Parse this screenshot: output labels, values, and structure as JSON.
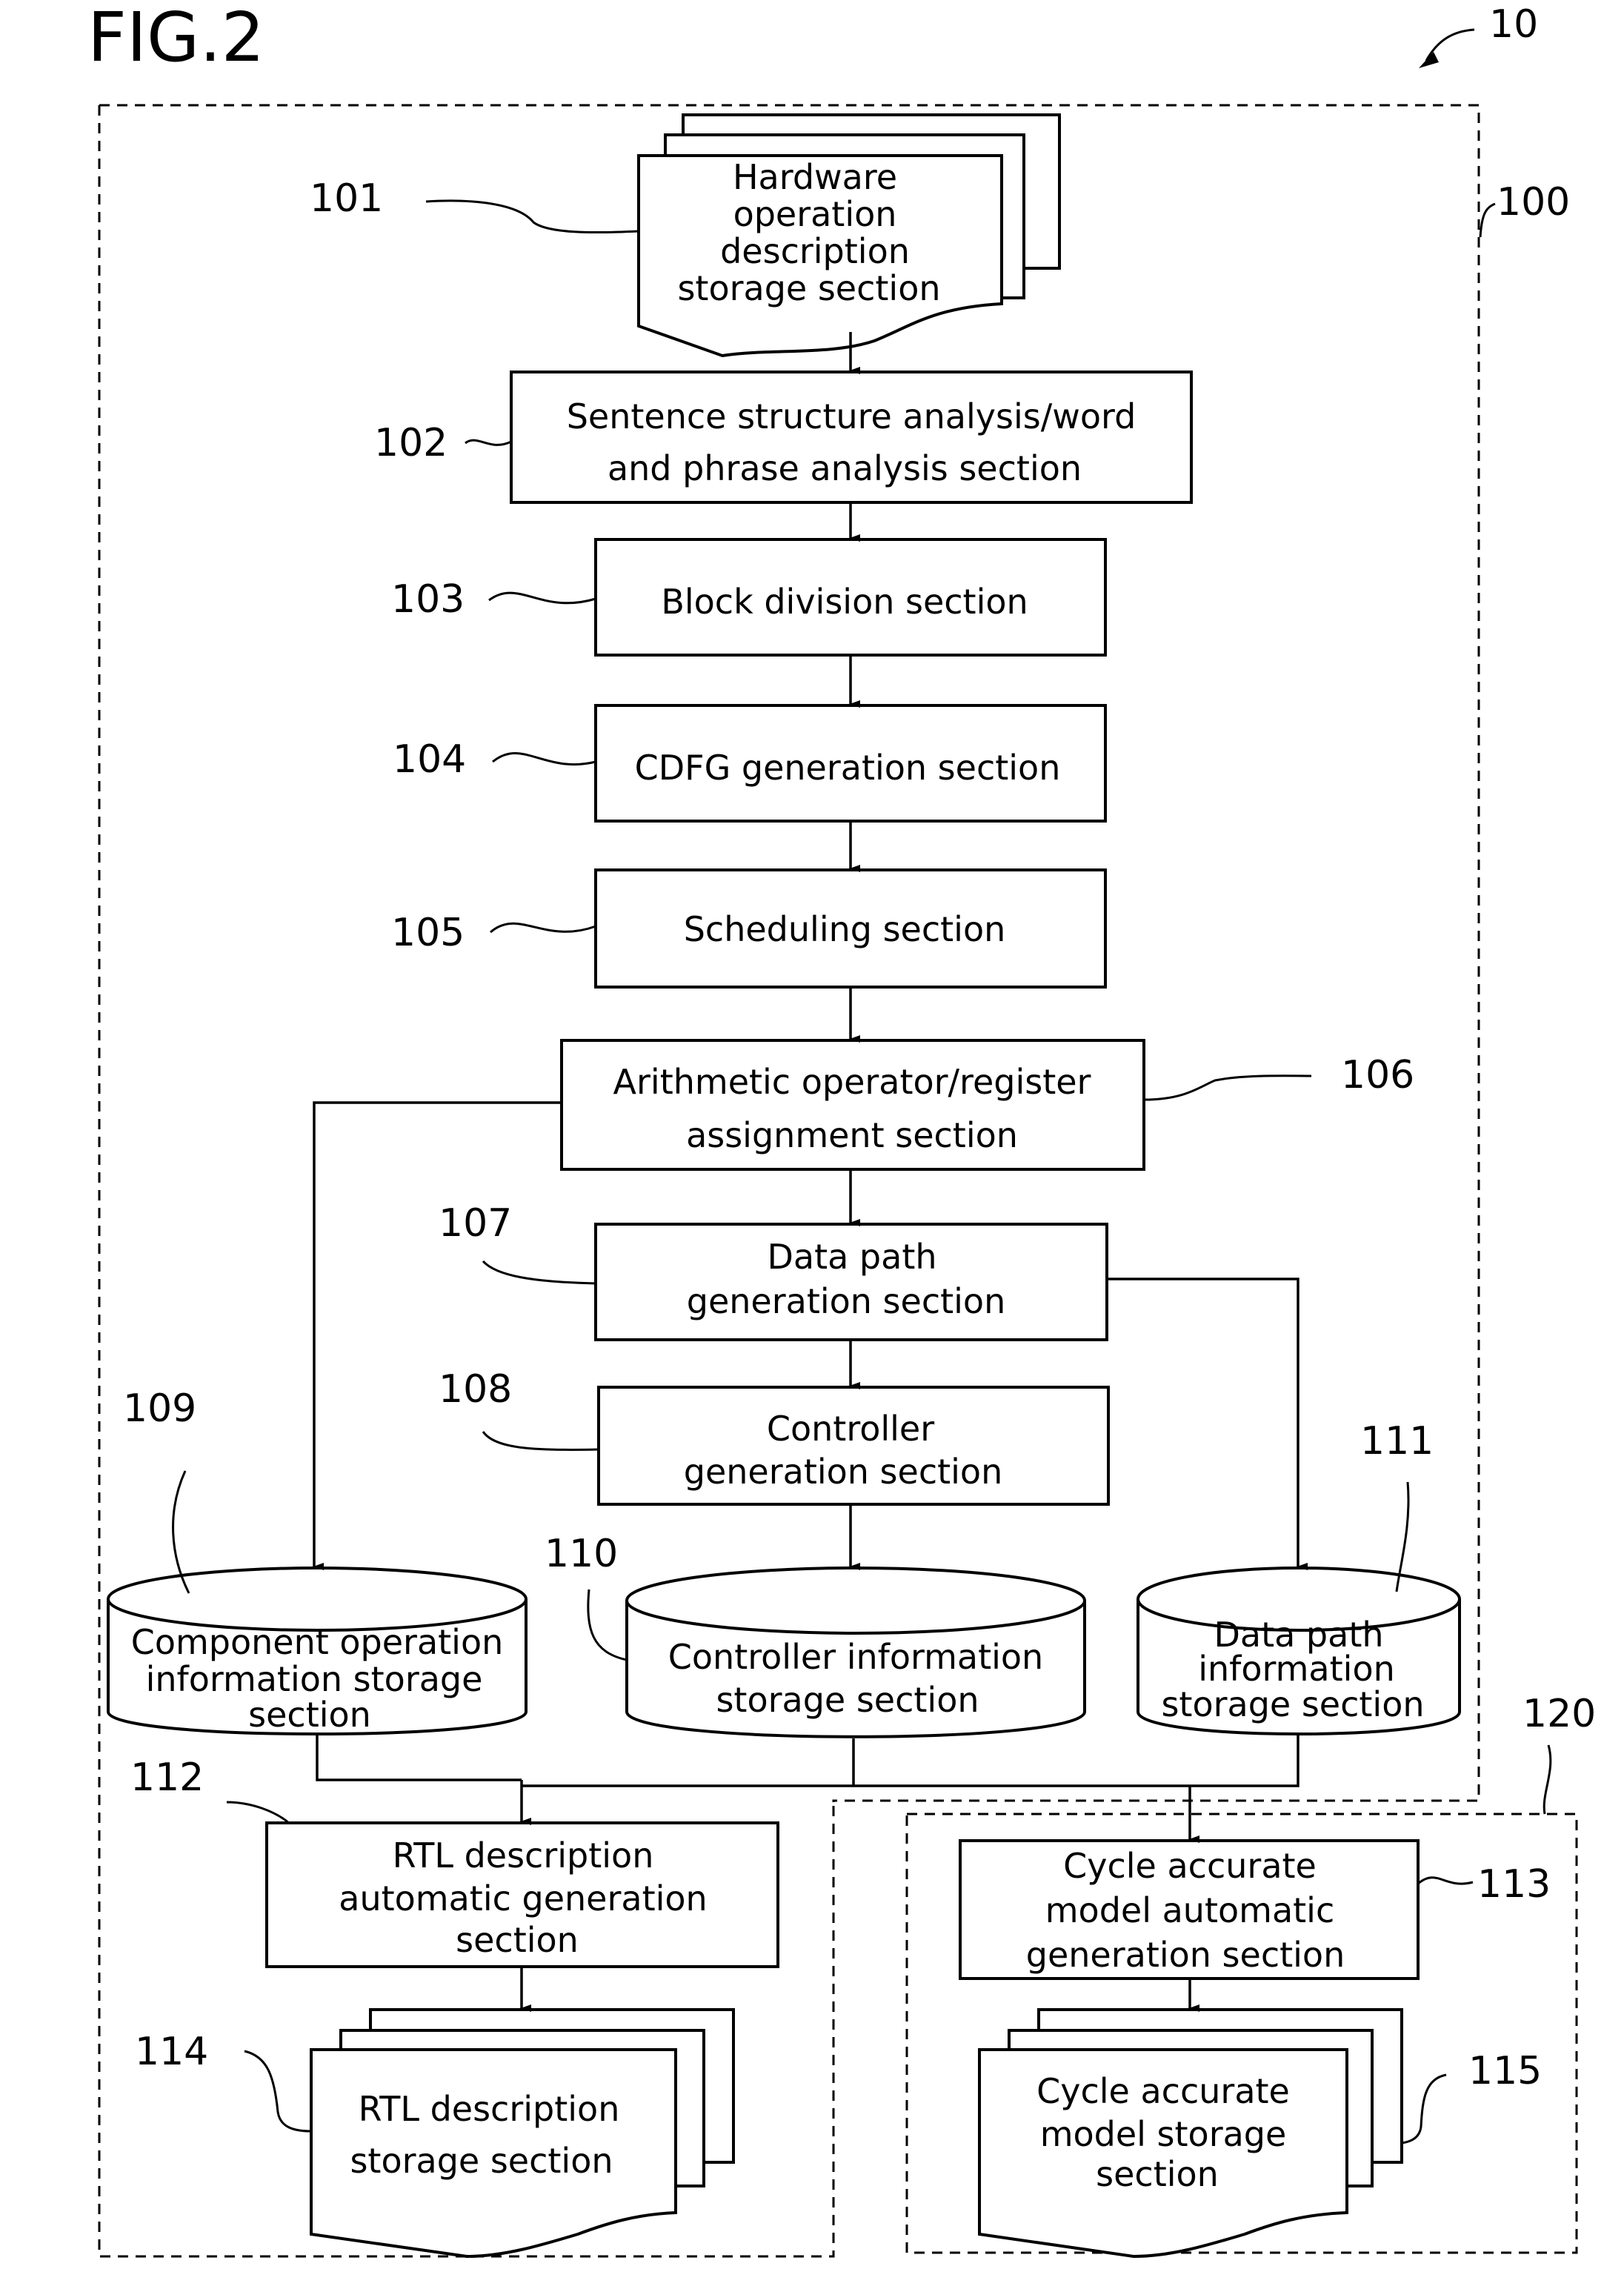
{
  "figure": {
    "title": "FIG.2",
    "system_ref": "10"
  },
  "regions": {
    "main_ref": "100",
    "model_ref": "120"
  },
  "nodes": {
    "n101": {
      "ref": "101",
      "lines": [
        "Hardware",
        "operation",
        "description",
        "storage section"
      ],
      "shape": "document-stack"
    },
    "n102": {
      "ref": "102",
      "lines": [
        "Sentence structure analysis/word",
        "and phrase analysis section"
      ],
      "shape": "process"
    },
    "n103": {
      "ref": "103",
      "lines": [
        "Block division section"
      ],
      "shape": "process"
    },
    "n104": {
      "ref": "104",
      "lines": [
        "CDFG generation section"
      ],
      "shape": "process"
    },
    "n105": {
      "ref": "105",
      "lines": [
        "Scheduling section"
      ],
      "shape": "process"
    },
    "n106": {
      "ref": "106",
      "lines": [
        "Arithmetic operator/register",
        "assignment section"
      ],
      "shape": "process"
    },
    "n107": {
      "ref": "107",
      "lines": [
        "Data path",
        "generation section"
      ],
      "shape": "process"
    },
    "n108": {
      "ref": "108",
      "lines": [
        "Controller",
        "generation section"
      ],
      "shape": "process"
    },
    "n109": {
      "ref": "109",
      "lines": [
        "Component operation",
        "information storage",
        "section"
      ],
      "shape": "database"
    },
    "n110": {
      "ref": "110",
      "lines": [
        "Controller information",
        "storage section"
      ],
      "shape": "database"
    },
    "n111": {
      "ref": "111",
      "lines": [
        "Data path",
        "information",
        "storage section"
      ],
      "shape": "database"
    },
    "n112": {
      "ref": "112",
      "lines": [
        "RTL description",
        "automatic generation",
        "section"
      ],
      "shape": "process"
    },
    "n113": {
      "ref": "113",
      "lines": [
        "Cycle accurate",
        "model automatic",
        "generation section"
      ],
      "shape": "process"
    },
    "n114": {
      "ref": "114",
      "lines": [
        "RTL description",
        "storage section"
      ],
      "shape": "document-stack"
    },
    "n115": {
      "ref": "115",
      "lines": [
        "Cycle accurate",
        "model storage",
        "section"
      ],
      "shape": "document-stack"
    }
  },
  "edges": [
    [
      "101",
      "102"
    ],
    [
      "102",
      "103"
    ],
    [
      "103",
      "104"
    ],
    [
      "104",
      "105"
    ],
    [
      "105",
      "106"
    ],
    [
      "106",
      "107"
    ],
    [
      "106",
      "109"
    ],
    [
      "107",
      "108"
    ],
    [
      "107",
      "111"
    ],
    [
      "108",
      "110"
    ],
    [
      "109",
      "112"
    ],
    [
      "110",
      "112"
    ],
    [
      "111",
      "112"
    ],
    [
      "109",
      "113"
    ],
    [
      "110",
      "113"
    ],
    [
      "111",
      "113"
    ],
    [
      "112",
      "114"
    ],
    [
      "113",
      "115"
    ]
  ]
}
